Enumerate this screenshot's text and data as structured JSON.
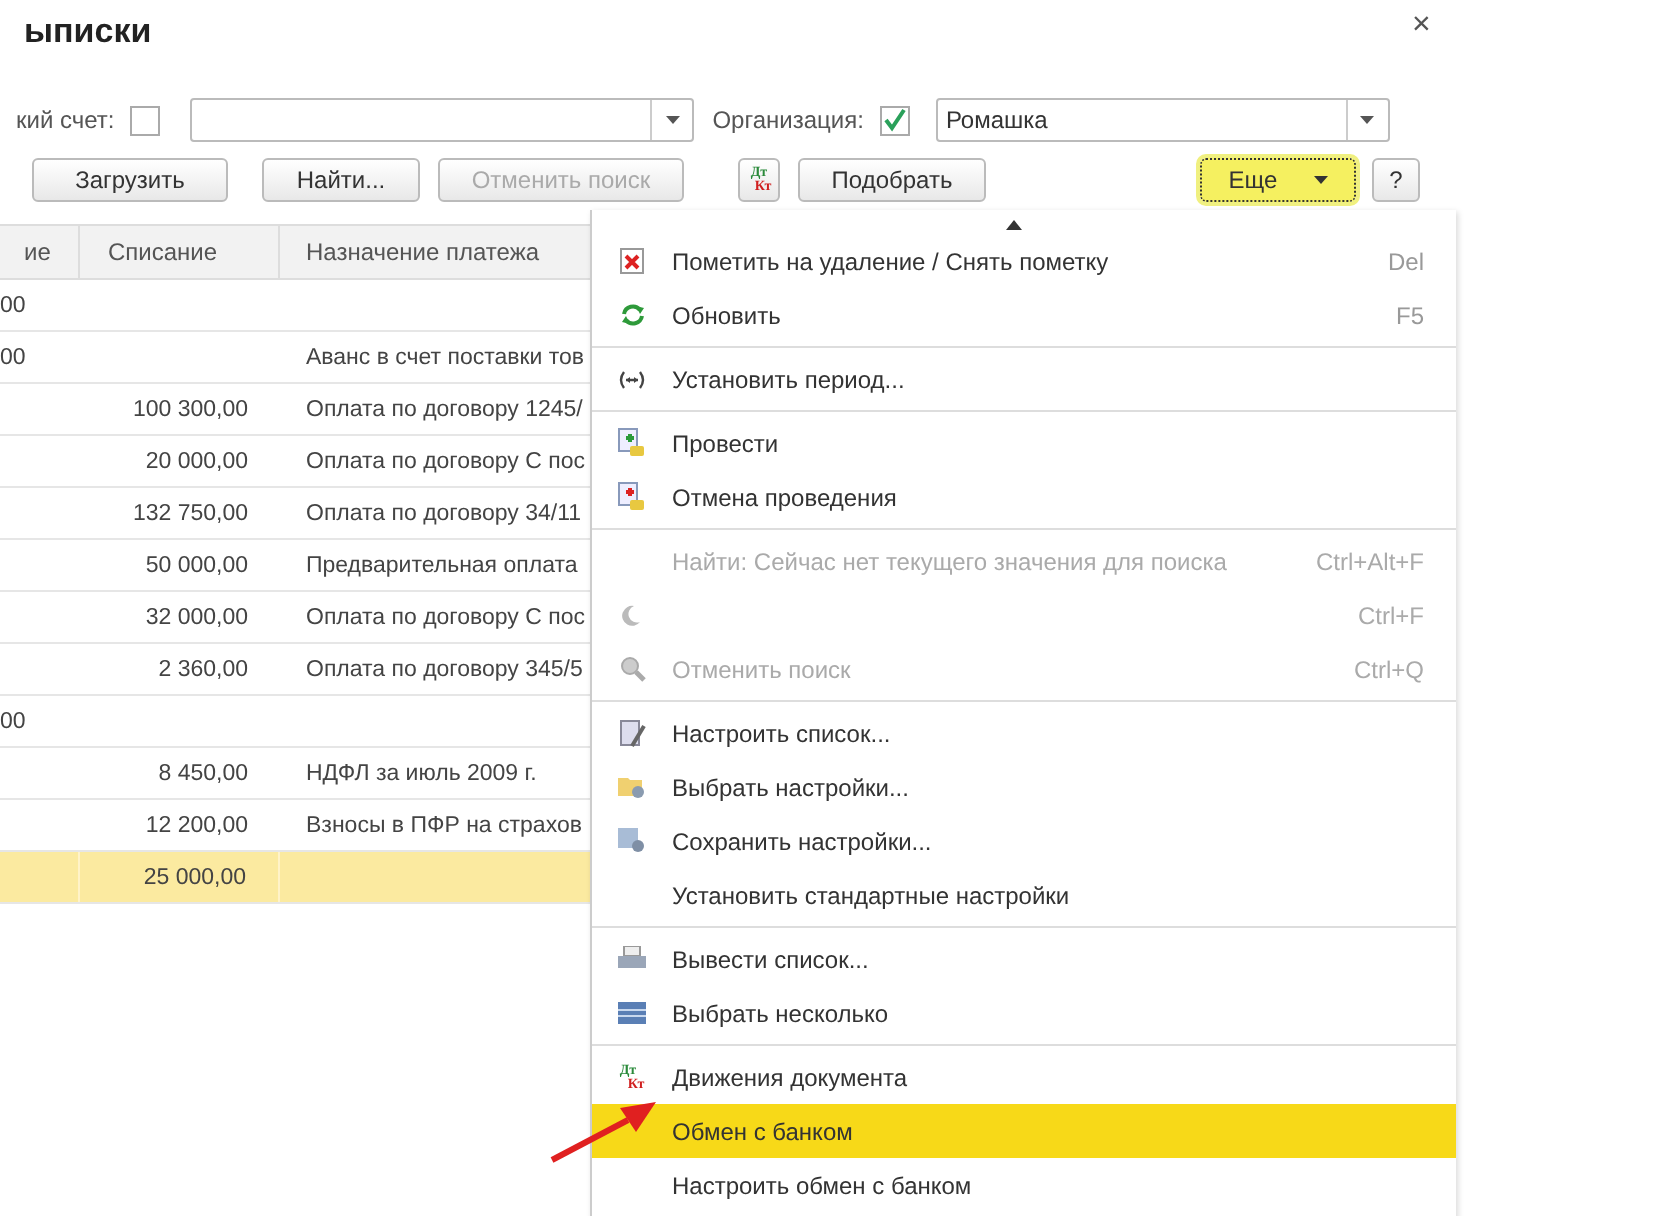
{
  "window": {
    "title": "ыписки",
    "close": "×"
  },
  "filters": [
    {
      "label": "кий счет:",
      "checked": false
    },
    {
      "label": "Организация:",
      "checked": true,
      "value": "Ромашка"
    }
  ],
  "toolbar": {
    "load": "Загрузить",
    "find": "Найти...",
    "cancel_find": {
      "label": "Отменить поиск",
      "disabled": true
    },
    "dtkt": {
      "top": "Дт",
      "bottom": "Кт"
    },
    "pick": "Подобрать",
    "more": {
      "label": "Еще",
      "selected": true
    },
    "help": "?"
  },
  "table": {
    "columns": [
      "ие",
      "Списание",
      "Назначение платежа"
    ],
    "rows": [
      {
        "cells": [
          "00",
          "",
          ""
        ],
        "selected": false
      },
      {
        "cells": [
          "00",
          "",
          "Аванс в счет поставки тов"
        ],
        "selected": false
      },
      {
        "cells": [
          "",
          "100 300,00",
          "Оплата по договору 1245/"
        ],
        "selected": false
      },
      {
        "cells": [
          "",
          "20 000,00",
          "Оплата по договору С пос"
        ],
        "selected": false
      },
      {
        "cells": [
          "",
          "132 750,00",
          "Оплата по договору 34/11"
        ],
        "selected": false
      },
      {
        "cells": [
          "",
          "50 000,00",
          "Предварительная оплата"
        ],
        "selected": false
      },
      {
        "cells": [
          "",
          "32 000,00",
          "Оплата по договору С пос"
        ],
        "selected": false
      },
      {
        "cells": [
          "",
          "2 360,00",
          "Оплата по договору 345/5"
        ],
        "selected": false
      },
      {
        "cells": [
          "00",
          "",
          ""
        ],
        "selected": false
      },
      {
        "cells": [
          "",
          "8 450,00",
          "НДФЛ за июль 2009 г."
        ],
        "selected": false
      },
      {
        "cells": [
          "",
          "12 200,00",
          "Взносы в ПФР на страхов"
        ],
        "selected": false
      },
      {
        "cells": [
          "",
          "25 000,00",
          ""
        ],
        "selected": true
      }
    ]
  },
  "menu": {
    "groups": [
      {
        "items": [
          {
            "label": "Пометить на удаление / Снять пометку",
            "shortcut": "Del",
            "disabled": false,
            "selected": false
          },
          {
            "label": "Обновить",
            "shortcut": "F5",
            "disabled": false,
            "selected": false
          }
        ]
      },
      {
        "items": [
          {
            "label": "Установить период...",
            "disabled": false,
            "selected": false
          }
        ]
      },
      {
        "items": [
          {
            "label": "Провести",
            "disabled": false,
            "selected": false
          },
          {
            "label": "Отмена проведения",
            "disabled": false,
            "selected": false
          }
        ]
      },
      {
        "items": [
          {
            "label": "Найти: Сейчас нет текущего значения для поиска",
            "shortcut": "Ctrl+Alt+F",
            "disabled": true,
            "selected": false
          },
          {
            "shortcut": "Ctrl+F",
            "disabled": true,
            "selected": false
          },
          {
            "label": "Отменить поиск",
            "shortcut": "Ctrl+Q",
            "disabled": true,
            "selected": false
          }
        ]
      },
      {
        "items": [
          {
            "label": "Настроить список...",
            "disabled": false,
            "selected": false
          },
          {
            "label": "Выбрать настройки...",
            "disabled": false,
            "selected": false
          },
          {
            "label": "Сохранить настройки...",
            "disabled": false,
            "selected": false
          },
          {
            "label": "Установить стандартные настройки",
            "disabled": false,
            "selected": false
          }
        ]
      },
      {
        "items": [
          {
            "label": "Вывести список...",
            "disabled": false,
            "selected": false
          },
          {
            "label": "Выбрать несколько",
            "disabled": false,
            "selected": false
          }
        ]
      },
      {
        "items": [
          {
            "icon_text": [
              "Дт",
              "Кт"
            ],
            "label": "Движения документа",
            "disabled": false,
            "selected": false
          },
          {
            "label": "Обмен с банком",
            "disabled": false,
            "selected": true
          },
          {
            "label": "Настроить обмен с банком",
            "disabled": false,
            "selected": false
          }
        ]
      }
    ]
  }
}
